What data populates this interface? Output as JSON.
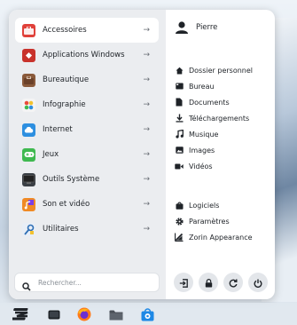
{
  "categories": [
    {
      "label": "Accessoires",
      "icon": "accessories-icon",
      "color": "#e0413a"
    },
    {
      "label": "Applications Windows",
      "icon": "windows-apps-icon",
      "color": "#c8322b"
    },
    {
      "label": "Bureautique",
      "icon": "office-icon",
      "color": "#8a5a3b"
    },
    {
      "label": "Infographie",
      "icon": "graphics-icon",
      "color": "#f2c230"
    },
    {
      "label": "Internet",
      "icon": "internet-cloud-icon",
      "color": "#2d8fe0"
    },
    {
      "label": "Jeux",
      "icon": "games-icon",
      "color": "#3fb950"
    },
    {
      "label": "Outils Système",
      "icon": "system-tools-icon",
      "color": "#3a3f45"
    },
    {
      "label": "Son et vidéo",
      "icon": "sound-video-icon",
      "color": "#f08a24"
    },
    {
      "label": "Utilitaires",
      "icon": "utilities-icon",
      "color": "#2f6fb5"
    }
  ],
  "search": {
    "placeholder": "Rechercher..."
  },
  "user": {
    "name": "Pierre"
  },
  "places": [
    {
      "label": "Dossier personnel",
      "icon": "home-icon"
    },
    {
      "label": "Bureau",
      "icon": "desktop-icon"
    },
    {
      "label": "Documents",
      "icon": "document-icon"
    },
    {
      "label": "Téléchargements",
      "icon": "download-icon"
    },
    {
      "label": "Musique",
      "icon": "music-icon"
    },
    {
      "label": "Images",
      "icon": "image-icon"
    },
    {
      "label": "Vidéos",
      "icon": "video-icon"
    }
  ],
  "system": [
    {
      "label": "Logiciels",
      "icon": "software-icon"
    },
    {
      "label": "Paramètres",
      "icon": "settings-gear-icon"
    },
    {
      "label": "Zorin Appearance",
      "icon": "appearance-icon"
    }
  ],
  "power_buttons": [
    "logout-icon",
    "lock-icon",
    "restart-icon",
    "power-icon"
  ],
  "taskbar": [
    "zorin-menu-icon",
    "workspace-icon",
    "firefox-icon",
    "files-icon",
    "software-store-icon"
  ]
}
